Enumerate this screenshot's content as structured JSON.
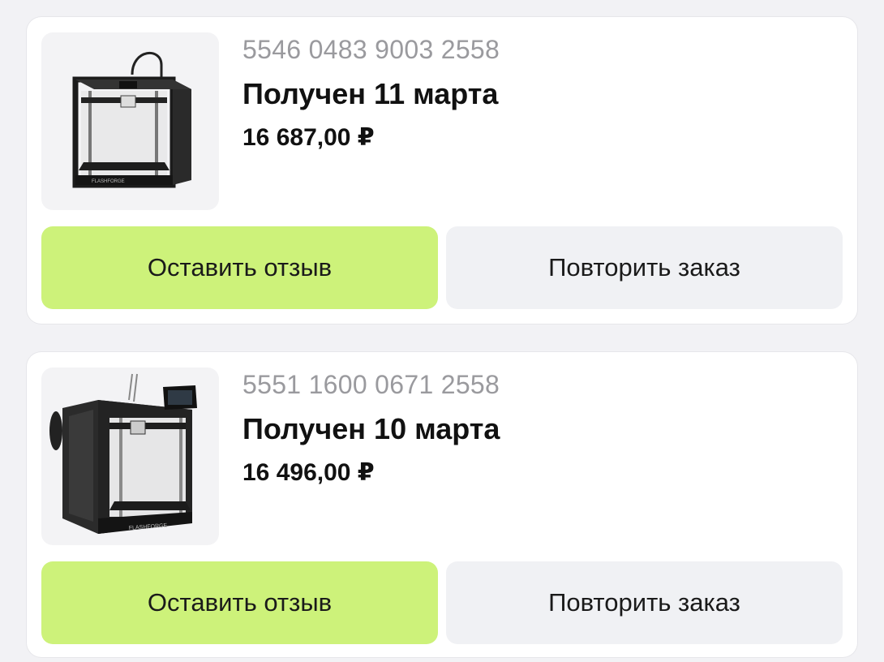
{
  "orders": [
    {
      "id": "5546 0483 9003 2558",
      "status": "Получен 11 марта",
      "price": "16 687,00 ₽",
      "review_label": "Оставить отзыв",
      "repeat_label": "Повторить заказ"
    },
    {
      "id": "5551 1600 0671 2558",
      "status": "Получен 10 марта",
      "price": "16 496,00 ₽",
      "review_label": "Оставить отзыв",
      "repeat_label": "Повторить заказ"
    }
  ],
  "colors": {
    "review_button": "#cdf27a",
    "repeat_button": "#f0f1f4",
    "background": "#f2f2f5"
  }
}
